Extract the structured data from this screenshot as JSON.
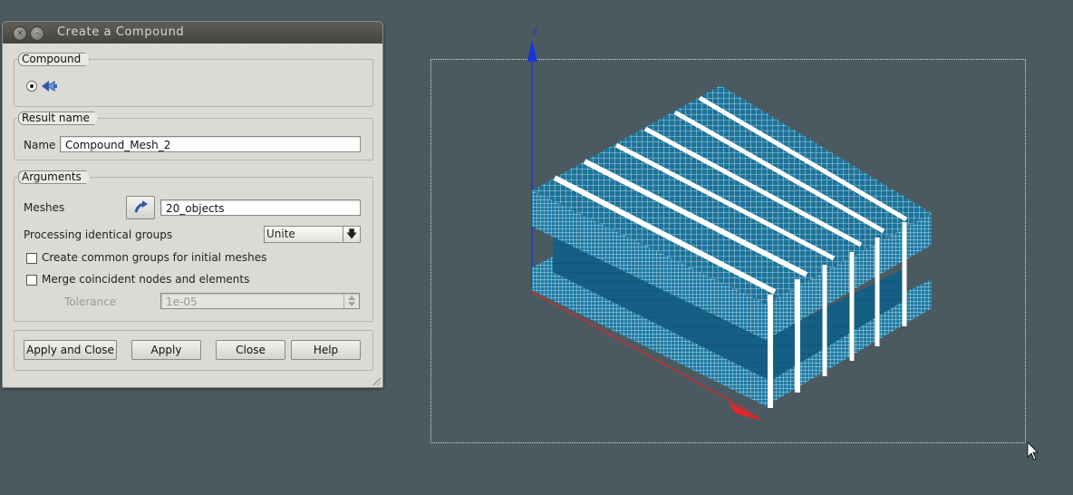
{
  "dialog": {
    "title": "Create a Compound",
    "groups": {
      "compound": {
        "label": "Compound"
      },
      "result": {
        "label": "Result name",
        "name_label": "Name",
        "name_value": "Compound_Mesh_2"
      },
      "arguments": {
        "label": "Arguments",
        "meshes_label": "Meshes",
        "meshes_value": "20_objects",
        "processing_label": "Processing identical groups",
        "processing_value": "Unite",
        "common_groups_label": "Create common groups for initial meshes",
        "merge_label": "Merge coincident nodes and elements",
        "tolerance_label": "Tolerance",
        "tolerance_value": "1e-05"
      }
    },
    "buttons": {
      "apply_close": "Apply and Close",
      "apply": "Apply",
      "close": "Close",
      "help": "Help"
    }
  },
  "viewer": {
    "axis_z_label": "z",
    "colors": {
      "mesh": "#1d7399",
      "mesh_line": "#ffffff",
      "axis_z": "#1537d6",
      "axis_x": "#e2262a",
      "background": "#4b5a60"
    }
  }
}
